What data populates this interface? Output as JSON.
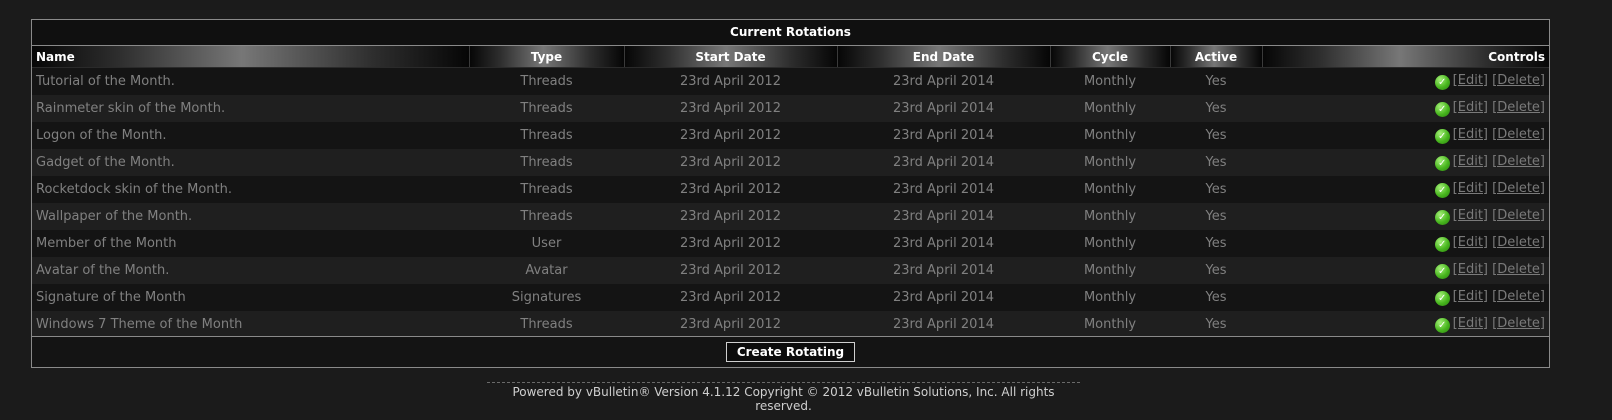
{
  "panel": {
    "title": "Current Rotations",
    "columns": {
      "name": "Name",
      "type": "Type",
      "start": "Start Date",
      "end": "End Date",
      "cycle": "Cycle",
      "active": "Active",
      "controls": "Controls"
    },
    "rows": [
      {
        "name": "Tutorial of the Month.",
        "type": "Threads",
        "start": "23rd April 2012",
        "end": "23rd April 2014",
        "cycle": "Monthly",
        "active": "Yes"
      },
      {
        "name": "Rainmeter skin of the Month.",
        "type": "Threads",
        "start": "23rd April 2012",
        "end": "23rd April 2014",
        "cycle": "Monthly",
        "active": "Yes"
      },
      {
        "name": "Logon of the Month.",
        "type": "Threads",
        "start": "23rd April 2012",
        "end": "23rd April 2014",
        "cycle": "Monthly",
        "active": "Yes"
      },
      {
        "name": "Gadget of the Month.",
        "type": "Threads",
        "start": "23rd April 2012",
        "end": "23rd April 2014",
        "cycle": "Monthly",
        "active": "Yes"
      },
      {
        "name": "Rocketdock skin of the Month.",
        "type": "Threads",
        "start": "23rd April 2012",
        "end": "23rd April 2014",
        "cycle": "Monthly",
        "active": "Yes"
      },
      {
        "name": "Wallpaper of the Month.",
        "type": "Threads",
        "start": "23rd April 2012",
        "end": "23rd April 2014",
        "cycle": "Monthly",
        "active": "Yes"
      },
      {
        "name": "Member of the Month",
        "type": "User",
        "start": "23rd April 2012",
        "end": "23rd April 2014",
        "cycle": "Monthly",
        "active": "Yes"
      },
      {
        "name": "Avatar of the Month.",
        "type": "Avatar",
        "start": "23rd April 2012",
        "end": "23rd April 2014",
        "cycle": "Monthly",
        "active": "Yes"
      },
      {
        "name": "Signature of the Month",
        "type": "Signatures",
        "start": "23rd April 2012",
        "end": "23rd April 2014",
        "cycle": "Monthly",
        "active": "Yes"
      },
      {
        "name": "Windows 7 Theme of the Month",
        "type": "Threads",
        "start": "23rd April 2012",
        "end": "23rd April 2014",
        "cycle": "Monthly",
        "active": "Yes"
      }
    ],
    "edit_label": "[Edit]",
    "delete_label": "[Delete]",
    "status_icon": "check-circle-icon",
    "create_label": "Create Rotating"
  },
  "footer": {
    "copyright": "Powered by vBulletin® Version 4.1.12 Copyright © 2012 vBulletin Solutions, Inc. All rights reserved."
  },
  "colors": {
    "background": "#1b1b1b",
    "row_dark": "#141414",
    "row_light": "#1f1f1f",
    "header_text": "#ffffff",
    "cell_text": "#808080",
    "check_green": "#48b61e"
  }
}
